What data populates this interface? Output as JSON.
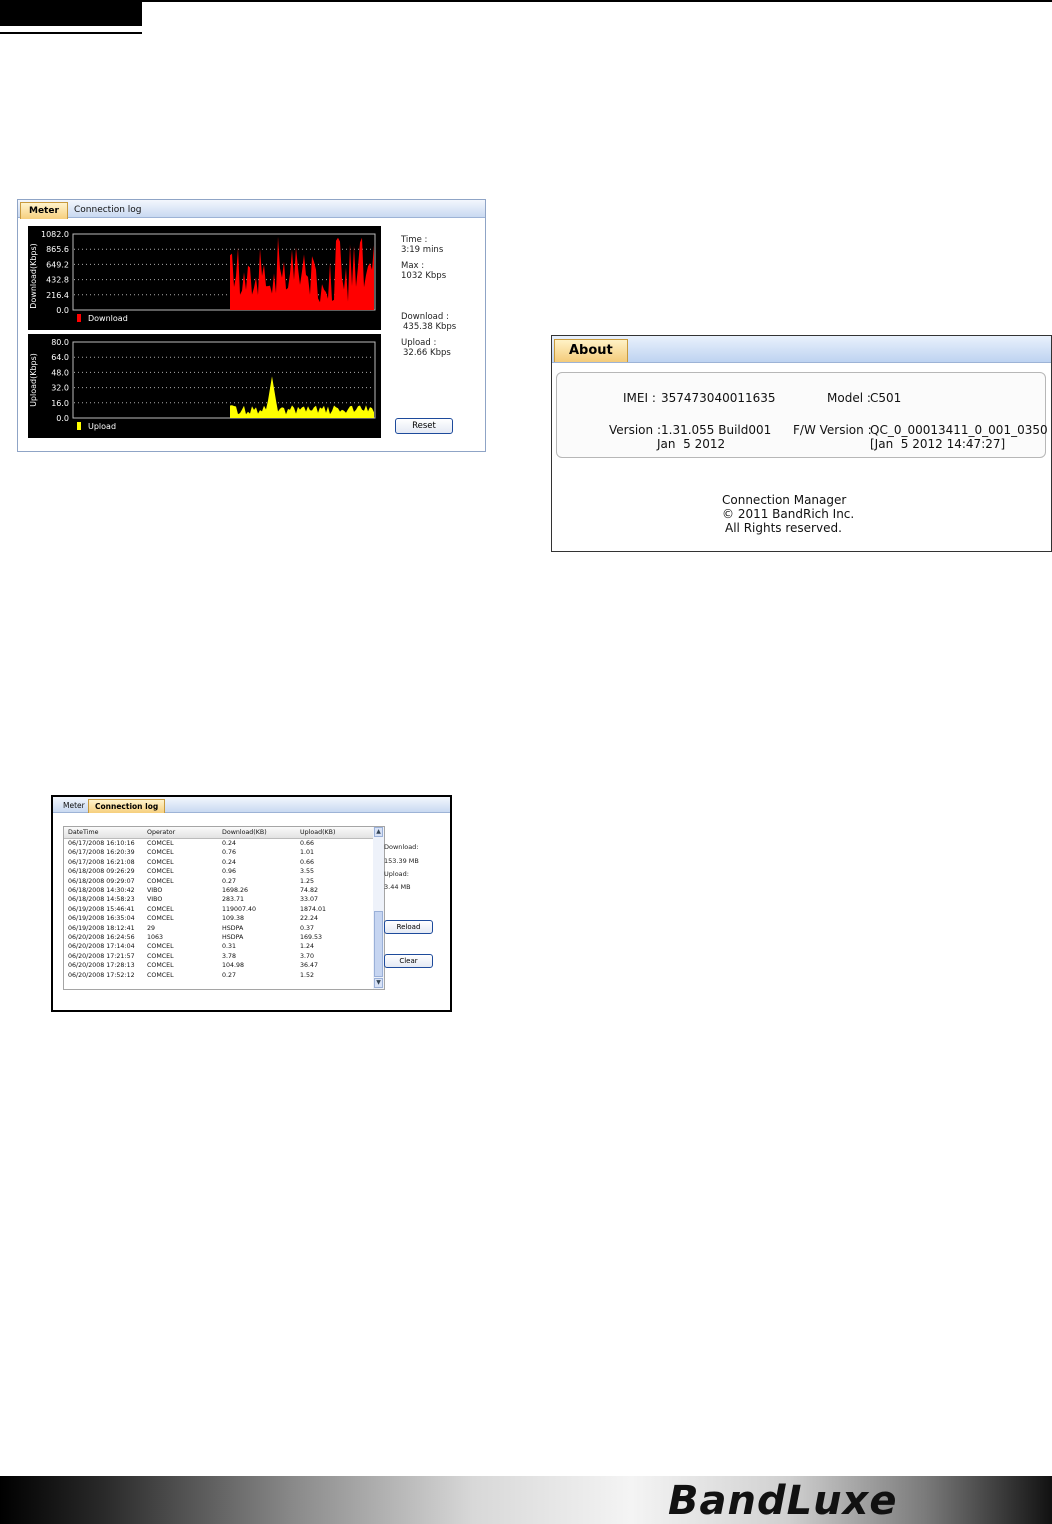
{
  "meter": {
    "tabs": [
      "Meter",
      "Connection log"
    ],
    "download_graph": {
      "ylabel": "Download(Kbps)",
      "ticks": [
        "1082.0",
        "865.6",
        "649.2",
        "432.8",
        "216.4",
        "0.0"
      ],
      "legend": "Download",
      "color": "#ff0000"
    },
    "upload_graph": {
      "ylabel": "Upload(Kbps)",
      "ticks": [
        "80.0",
        "64.0",
        "48.0",
        "32.0",
        "16.0",
        "0.0"
      ],
      "legend": "Upload",
      "color": "#ffff00"
    },
    "time_label": "Time :",
    "time_value": "3:19 mins",
    "max_label": "Max :",
    "max_value": "1032 Kbps",
    "download_label": "Download :",
    "download_value": "435.38 Kbps",
    "upload_label": "Upload :",
    "upload_value": "32.66 Kbps",
    "reset_button": "Reset"
  },
  "about": {
    "tab": "About",
    "imei_label": "IMEI :",
    "imei_value": "357473040011635",
    "model_label": "Model :",
    "model_value": "C501",
    "version_label": "Version :",
    "version_value": "1.31.055 Build001",
    "version_date": "Jan  5 2012",
    "fw_label": "F/W Version :",
    "fw_value": "QC_0_00013411_0_001_0350",
    "fw_date": "[Jan  5 2012 14:47:27]",
    "footer_line1": "Connection Manager",
    "footer_line2": "© 2011 BandRich Inc.",
    "footer_line3": "All Rights reserved."
  },
  "log": {
    "tabs": [
      "Meter",
      "Connection log"
    ],
    "columns": [
      "DateTime",
      "Operator",
      "Download(KB)",
      "Upload(KB)"
    ],
    "rows": [
      [
        "06/17/2008 16:10:16",
        "COMCEL",
        "0.24",
        "0.66"
      ],
      [
        "06/17/2008 16:20:39",
        "COMCEL",
        "0.76",
        "1.01"
      ],
      [
        "06/17/2008 16:21:08",
        "COMCEL",
        "0.24",
        "0.66"
      ],
      [
        "06/18/2008 09:26:29",
        "COMCEL",
        "0.96",
        "3.55"
      ],
      [
        "06/18/2008 09:29:07",
        "COMCEL",
        "0.27",
        "1.25"
      ],
      [
        "06/18/2008 14:30:42",
        "VIBO",
        "1698.26",
        "74.82"
      ],
      [
        "06/18/2008 14:58:23",
        "VIBO",
        "283.71",
        "33.07"
      ],
      [
        "06/19/2008 15:46:41",
        "COMCEL",
        "119007.40",
        "1874.01"
      ],
      [
        "06/19/2008 16:35:04",
        "COMCEL",
        "109.38",
        "22.24"
      ],
      [
        "06/19/2008 18:12:41",
        "29",
        "HSDPA",
        "0.37"
      ],
      [
        "06/20/2008 16:24:56",
        "1063",
        "HSDPA",
        "169.53"
      ],
      [
        "06/20/2008 17:14:04",
        "COMCEL",
        "0.31",
        "1.24"
      ],
      [
        "06/20/2008 17:21:57",
        "COMCEL",
        "3.78",
        "3.70"
      ],
      [
        "06/20/2008 17:28:13",
        "COMCEL",
        "104.98",
        "36.47"
      ],
      [
        "06/20/2008 17:52:12",
        "COMCEL",
        "0.27",
        "1.52"
      ]
    ],
    "download_label": "Download:",
    "download_value": "153.39 MB",
    "upload_label": "Upload:",
    "upload_value": "3.44 MB",
    "reload_button": "Reload",
    "clear_button": "Clear"
  },
  "footer": {
    "logo": "BandLuxe"
  }
}
